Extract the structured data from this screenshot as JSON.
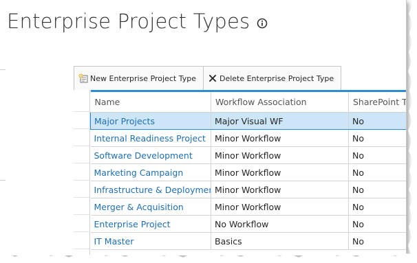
{
  "page": {
    "title": "Enterprise Project Types"
  },
  "toolbar": {
    "new_label": "New Enterprise Project Type",
    "delete_label": "Delete Enterprise Project Type"
  },
  "grid": {
    "headers": [
      "Name",
      "Workflow Association",
      "SharePoint Ta"
    ],
    "selected_index": 0,
    "rows": [
      {
        "name": "Major Projects",
        "workflow": "Major Visual WF",
        "sharepoint": "No"
      },
      {
        "name": "Internal Readiness Project",
        "workflow": "Minor Workflow",
        "sharepoint": "No"
      },
      {
        "name": "Software Development",
        "workflow": "Minor Workflow",
        "sharepoint": "No"
      },
      {
        "name": "Marketing Campaign",
        "workflow": "Minor Workflow",
        "sharepoint": "No"
      },
      {
        "name": "Infrastructure & Deployment",
        "workflow": "Minor Workflow",
        "sharepoint": "No"
      },
      {
        "name": "Merger & Acquisition",
        "workflow": "Minor Workflow",
        "sharepoint": "No"
      },
      {
        "name": "Enterprise Project",
        "workflow": "No Workflow",
        "sharepoint": "No"
      },
      {
        "name": "IT Master",
        "workflow": "Basics",
        "sharepoint": "No"
      }
    ]
  },
  "icons": {
    "info": "info-circle-icon",
    "new": "new-document-icon",
    "delete": "close-x-icon"
  },
  "colors": {
    "accent": "#2a8dd4",
    "link": "#1f6fb5",
    "selected_row": "#cde6f7",
    "title_text": "#333333"
  }
}
